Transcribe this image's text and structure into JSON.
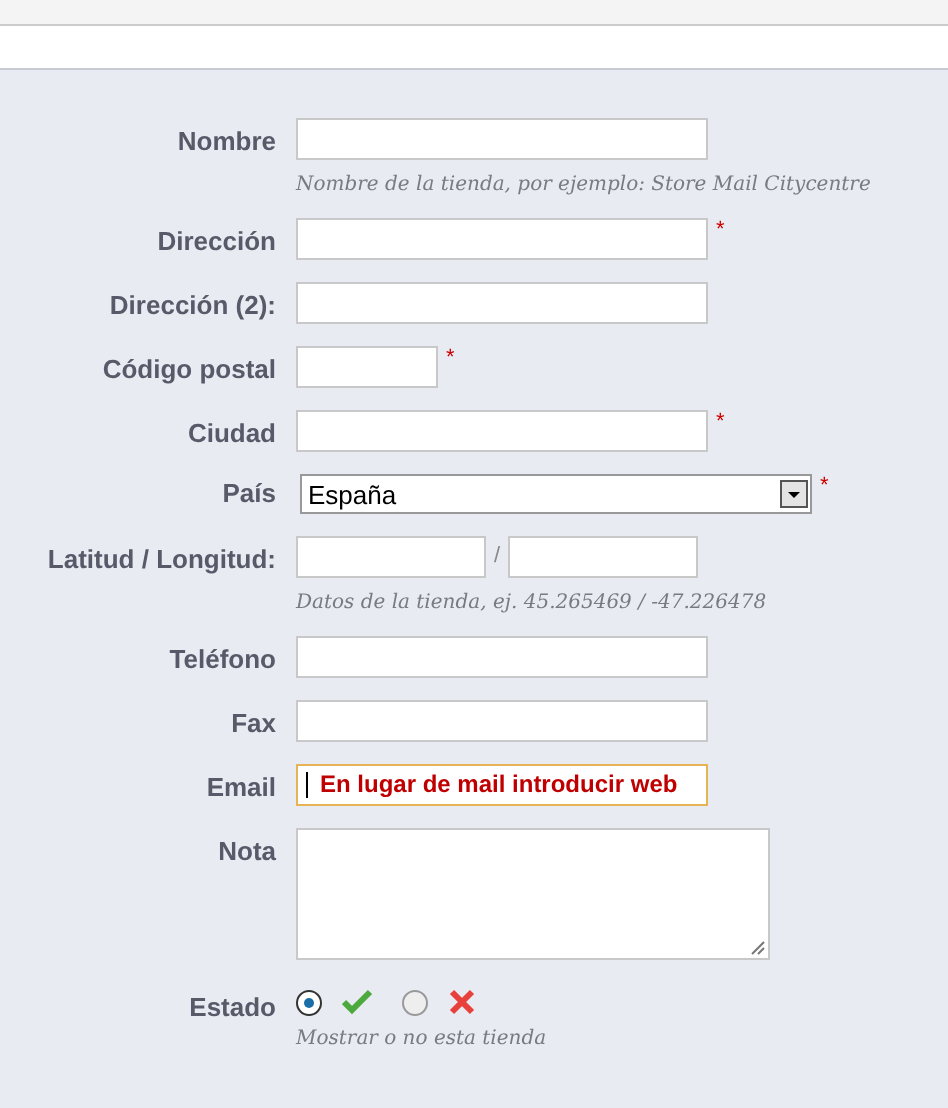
{
  "fields": [
    {
      "kind": "text",
      "label": "Nombre",
      "hint": "Nombre de la tienda, por ejemplo: Store Mail Citycentre"
    },
    {
      "kind": "text",
      "label": "Dirección",
      "required_mark": "*"
    },
    {
      "kind": "text",
      "label": "Dirección (2):"
    },
    {
      "kind": "short",
      "label": "Código postal",
      "required_mark": "*"
    },
    {
      "kind": "text",
      "label": "Ciudad",
      "required_mark": "*"
    },
    {
      "kind": "select",
      "label": "País",
      "required_mark": "*",
      "value": "España"
    },
    {
      "kind": "pair",
      "label": "Latitud / Longitud:",
      "separator": "/",
      "hint": "Datos de la tienda, ej. 45.265469 / -47.226478"
    },
    {
      "kind": "text",
      "label": "Teléfono"
    },
    {
      "kind": "text",
      "label": "Fax"
    },
    {
      "kind": "text",
      "label": "Email",
      "focused": true,
      "value": "En lugar de mail introducir web"
    },
    {
      "kind": "textarea",
      "label": "Nota"
    },
    {
      "kind": "radio",
      "label": "Estado",
      "options": [
        {
          "kind": "yes",
          "selected": true
        },
        {
          "kind": "no",
          "selected": false
        }
      ],
      "hint": "Mostrar o no esta tienda"
    }
  ]
}
